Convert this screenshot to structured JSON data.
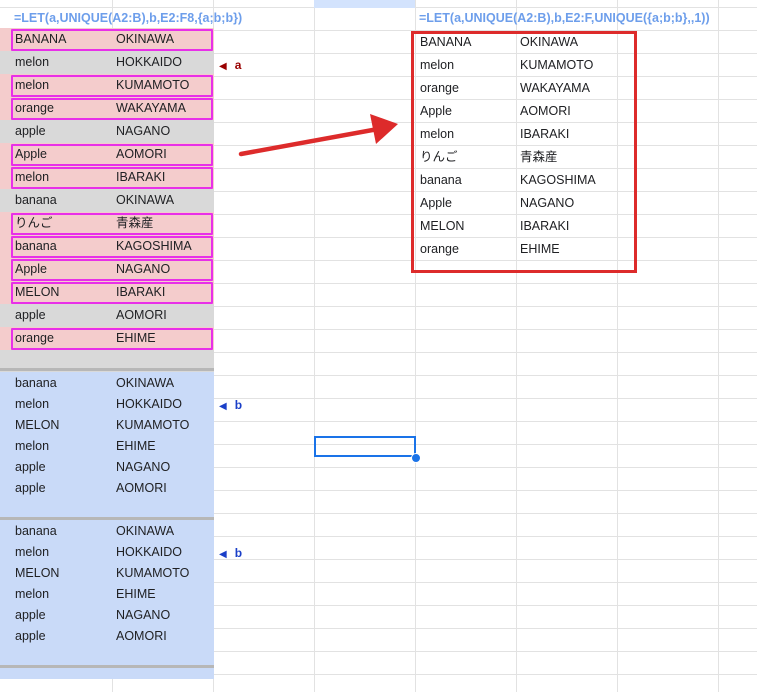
{
  "formula_left": "=LET(a,UNIQUE(A2:B),b,E2:F8,{a;b;b})",
  "formula_right": "=LET(a,UNIQUE(A2:B),b,E2:F,UNIQUE({a;b;b},,1))",
  "marker_a": "a",
  "marker_b": "b",
  "block_a": [
    {
      "c1": "BANANA",
      "c2": "OKINAWA",
      "hl": true
    },
    {
      "c1": "melon",
      "c2": "HOKKAIDO",
      "hl": false
    },
    {
      "c1": "melon",
      "c2": "KUMAMOTO",
      "hl": true
    },
    {
      "c1": "orange",
      "c2": "WAKAYAMA",
      "hl": true
    },
    {
      "c1": "apple",
      "c2": "NAGANO",
      "hl": false
    },
    {
      "c1": "Apple",
      "c2": "AOMORI",
      "hl": true
    },
    {
      "c1": "melon",
      "c2": "IBARAKI",
      "hl": true
    },
    {
      "c1": "banana",
      "c2": "OKINAWA",
      "hl": false
    },
    {
      "c1": "りんご",
      "c2": "青森産",
      "hl": true
    },
    {
      "c1": "banana",
      "c2": "KAGOSHIMA",
      "hl": true
    },
    {
      "c1": "Apple",
      "c2": "NAGANO",
      "hl": true
    },
    {
      "c1": "MELON",
      "c2": "IBARAKI",
      "hl": true
    },
    {
      "c1": "apple",
      "c2": "AOMORI",
      "hl": false
    },
    {
      "c1": "orange",
      "c2": "EHIME",
      "hl": true
    }
  ],
  "block_b1": [
    {
      "c1": "banana",
      "c2": "OKINAWA"
    },
    {
      "c1": "melon",
      "c2": "HOKKAIDO"
    },
    {
      "c1": "MELON",
      "c2": "KUMAMOTO"
    },
    {
      "c1": "melon",
      "c2": "EHIME"
    },
    {
      "c1": "apple",
      "c2": "NAGANO"
    },
    {
      "c1": "apple",
      "c2": "AOMORI"
    }
  ],
  "block_b2": [
    {
      "c1": "banana",
      "c2": "OKINAWA"
    },
    {
      "c1": "melon",
      "c2": "HOKKAIDO"
    },
    {
      "c1": "MELON",
      "c2": "KUMAMOTO"
    },
    {
      "c1": "melon",
      "c2": "EHIME"
    },
    {
      "c1": "apple",
      "c2": "NAGANO"
    },
    {
      "c1": "apple",
      "c2": "AOMORI"
    }
  ],
  "result": [
    {
      "c1": "BANANA",
      "c2": "OKINAWA"
    },
    {
      "c1": "melon",
      "c2": "KUMAMOTO"
    },
    {
      "c1": "orange",
      "c2": "WAKAYAMA"
    },
    {
      "c1": "Apple",
      "c2": "AOMORI"
    },
    {
      "c1": "melon",
      "c2": "IBARAKI"
    },
    {
      "c1": "りんご",
      "c2": "青森産"
    },
    {
      "c1": "banana",
      "c2": "KAGOSHIMA"
    },
    {
      "c1": "Apple",
      "c2": "NAGANO"
    },
    {
      "c1": "MELON",
      "c2": "IBARAKI"
    },
    {
      "c1": "orange",
      "c2": "EHIME"
    }
  ],
  "colors": {
    "highlight_pink": "#f4cccc",
    "unhighlighted_gray": "#d9d9d9",
    "block_b_blue": "#c9daf8",
    "magenta_outline": "#e830e8",
    "red_box_arrow": "#dd2b2b",
    "formula_text": "#6d9eeb",
    "marker_a": "#990000",
    "marker_b": "#1a3fc8",
    "selection": "#1a73e8"
  }
}
